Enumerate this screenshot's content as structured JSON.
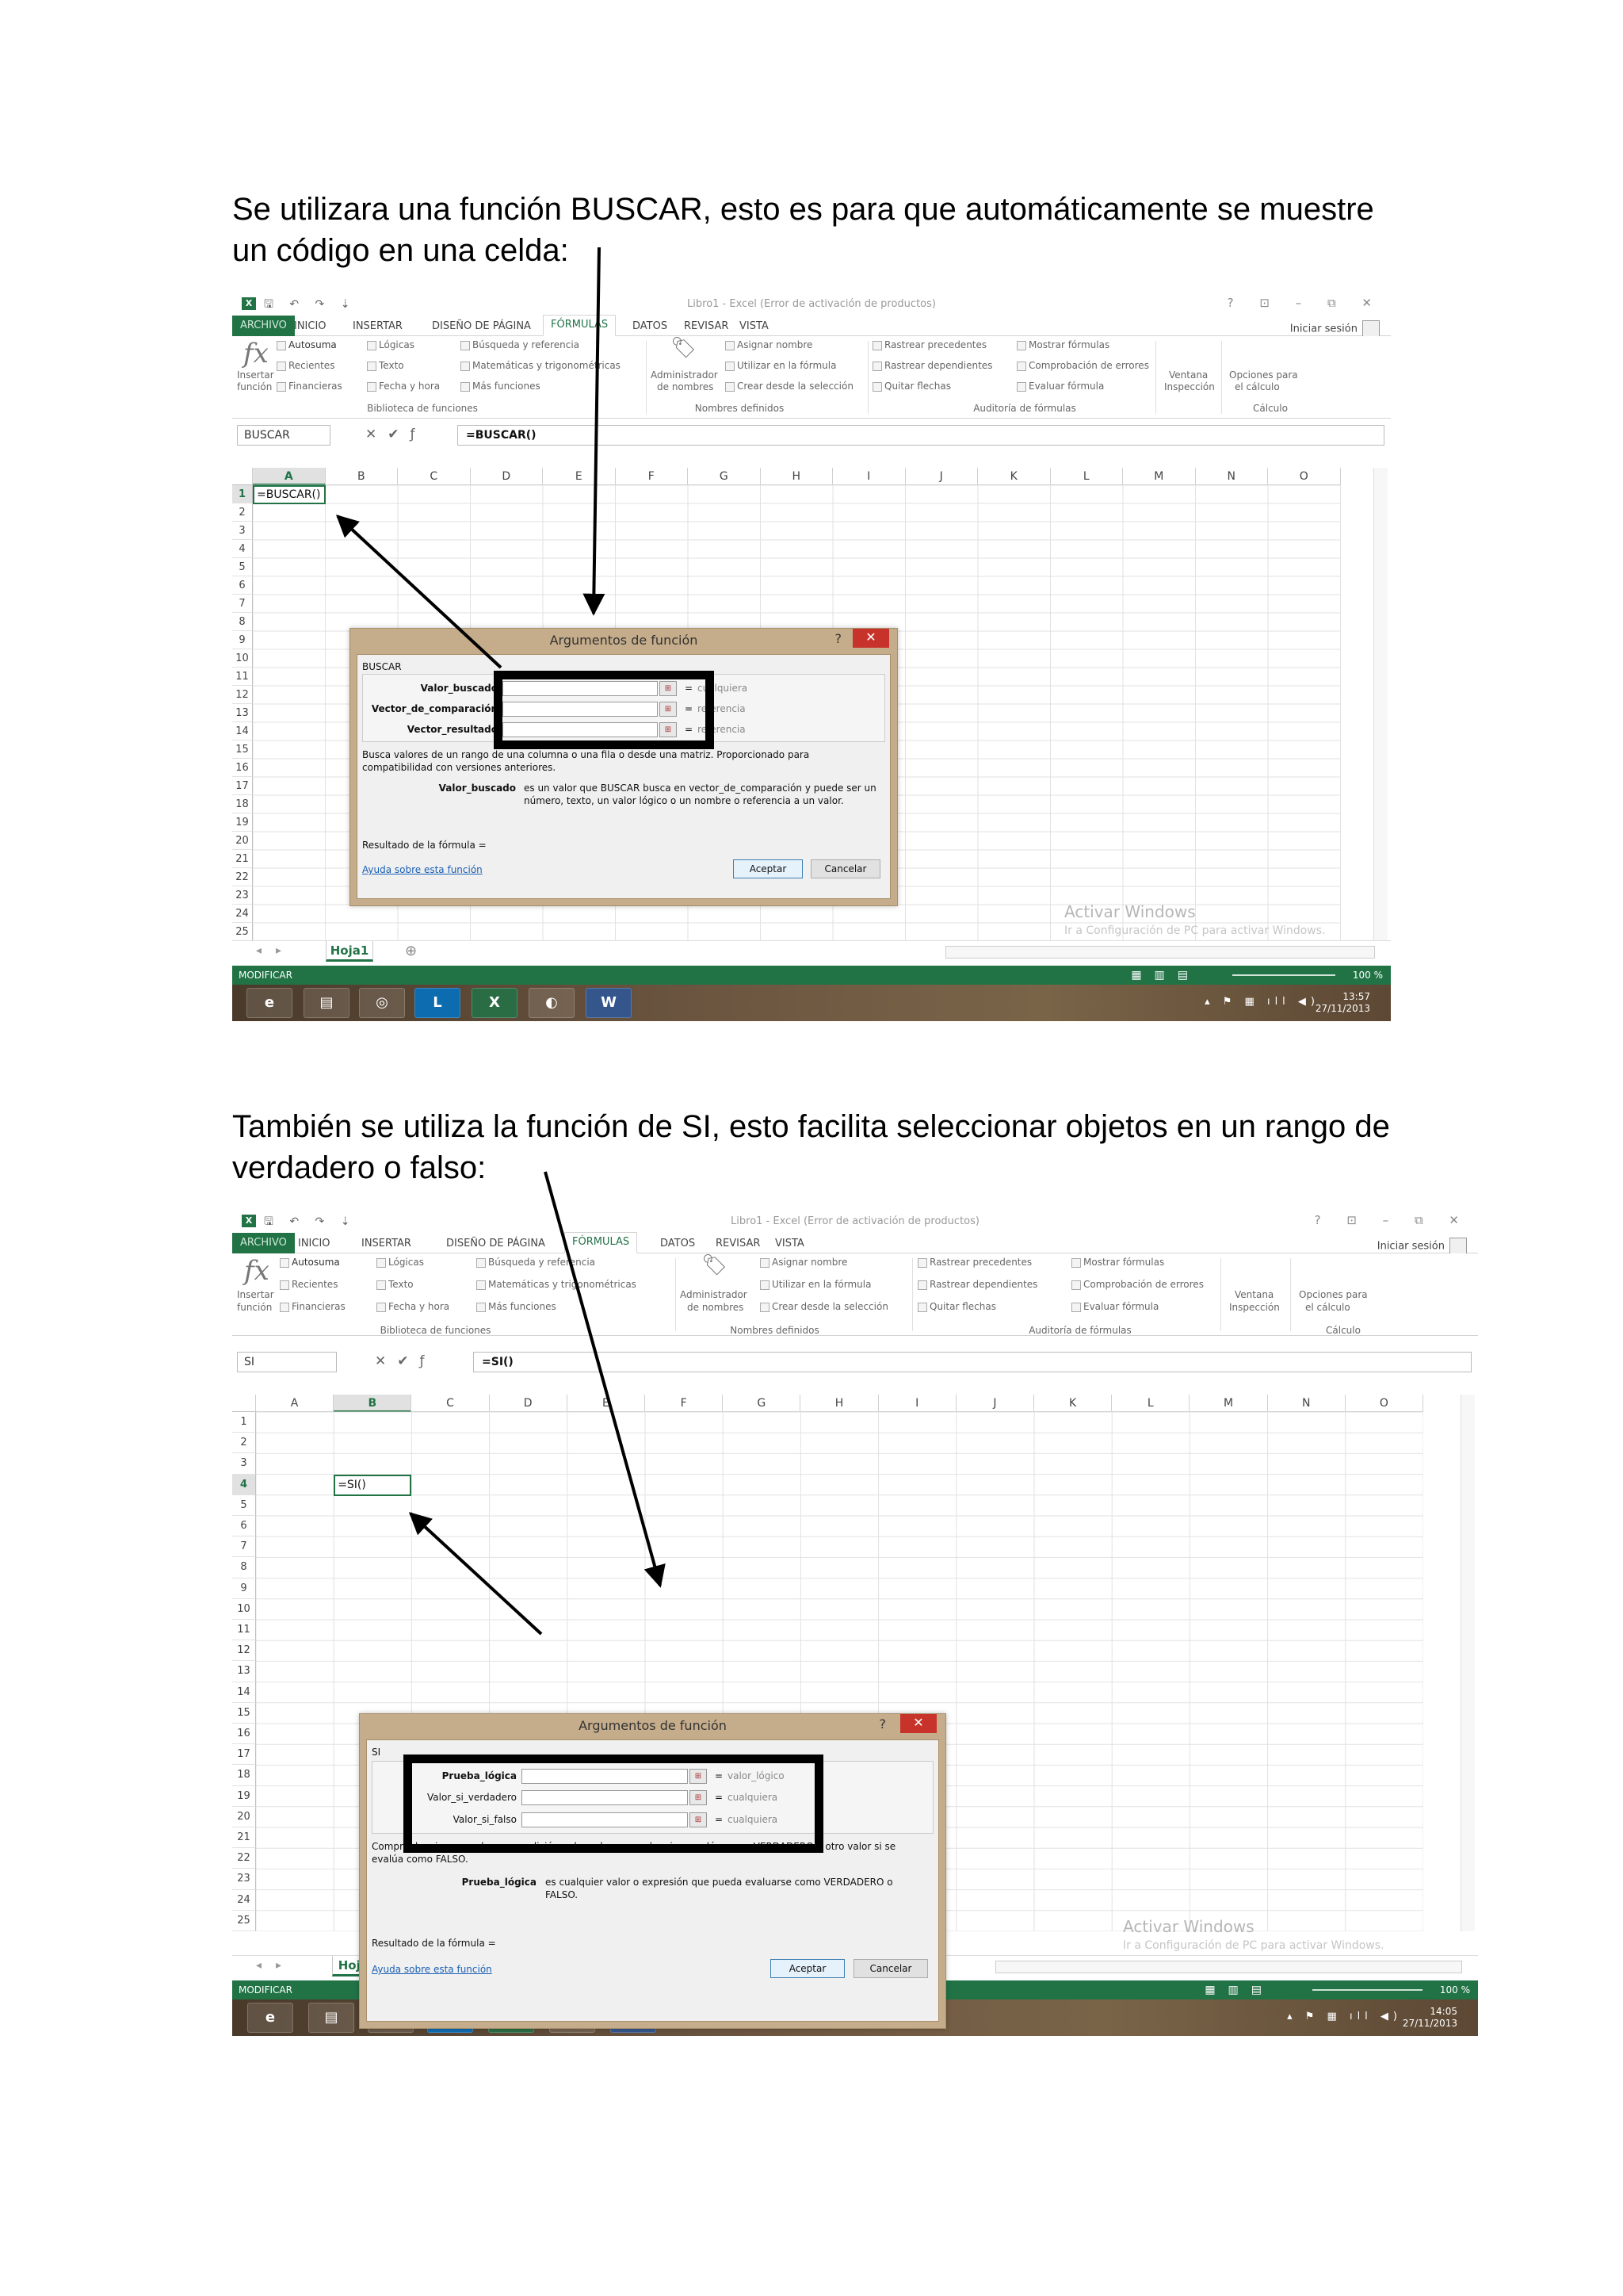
{
  "document": {
    "paragraph_1": "Se utilizara una función BUSCAR, esto es para que automáticamente se muestre un código en una celda:",
    "paragraph_2": "También se utiliza la función de SI, esto facilita seleccionar objetos en un rango de verdadero o falso:"
  },
  "excel_common": {
    "window_title": "Libro1 - Excel (Error de activación de productos)",
    "window_controls": "? ⊡ – ⧉ ✕",
    "quick_access": "🖫 ↶ ↷ ⇣",
    "tabs": [
      "ARCHIVO",
      "INICIO",
      "INSERTAR",
      "DISEÑO DE PÁGINA",
      "FÓRMULAS",
      "DATOS",
      "REVISAR",
      "VISTA"
    ],
    "active_tab": "FÓRMULAS",
    "signin": "Iniciar sesión",
    "ribbon": {
      "insert_function": "Insertar función",
      "insert_function_l1": "Insertar",
      "insert_function_l2": "función",
      "autosum": "Autosuma",
      "recent": "Recientes",
      "financial": "Financieras",
      "logical": "Lógicas",
      "text": "Texto",
      "datetime": "Fecha y hora",
      "lookup": "Búsqueda y referencia",
      "math": "Matemáticas y trigonométricas",
      "more": "Más funciones",
      "group_library": "Biblioteca de funciones",
      "name_manager_l1": "Administrador",
      "name_manager_l2": "de nombres",
      "define_name": "Asignar nombre",
      "use_in_formula": "Utilizar en la fórmula",
      "create_from_selection": "Crear desde la selección",
      "group_names": "Nombres definidos",
      "trace_precedents": "Rastrear precedentes",
      "trace_dependents": "Rastrear dependientes",
      "remove_arrows": "Quitar flechas",
      "show_formulas": "Mostrar fórmulas",
      "error_checking": "Comprobación de errores",
      "evaluate_formula": "Evaluar fórmula",
      "group_auditing": "Auditoría de fórmulas",
      "watch_window_l1": "Ventana",
      "watch_window_l2": "Inspección",
      "calc_options_l1": "Opciones para",
      "calc_options_l2": "el cálculo",
      "group_calc": "Cálculo"
    },
    "columns": [
      "A",
      "B",
      "C",
      "D",
      "E",
      "F",
      "G",
      "H",
      "I",
      "J",
      "K",
      "L",
      "M",
      "N",
      "O"
    ],
    "rows": [
      "1",
      "2",
      "3",
      "4",
      "5",
      "6",
      "7",
      "8",
      "9",
      "10",
      "11",
      "12",
      "13",
      "14",
      "15",
      "16",
      "17",
      "18",
      "19",
      "20",
      "21",
      "22",
      "23",
      "24",
      "25"
    ],
    "sheet_tab": "Hoja1",
    "add_sheet": "⊕",
    "status": "MODIFICAR",
    "zoom": "100 %",
    "watermark_title": "Activar Windows",
    "watermark_sub": "Ir a Configuración de PC para activar Windows.",
    "dialog_title": "Argumentos de función",
    "dialog_help": "?",
    "dialog_close": "✕",
    "formula_result": "Resultado de la fórmula =",
    "help_link": "Ayuda sobre esta función",
    "ok": "Aceptar",
    "cancel": "Cancelar",
    "eq": "="
  },
  "shot1": {
    "name_box": "BUSCAR",
    "formula": "=BUSCAR()",
    "active_cell_text": "=BUSCAR()",
    "active_col": "A",
    "active_row": "1",
    "function_name": "BUSCAR",
    "args": [
      {
        "label": "Valor_buscado",
        "hint": "cualquiera"
      },
      {
        "label": "Vector_de_comparación",
        "hint": "referencia"
      },
      {
        "label": "Vector_resultado",
        "hint": "referencia"
      }
    ],
    "description": "Busca valores de un rango de una columna o una fila o desde una matriz. Proporcionado para compatibilidad con versiones anteriores.",
    "arg_name": "Valor_buscado",
    "arg_description": "es un valor que BUSCAR busca en vector_de_comparación y puede ser un número, texto, un valor lógico o un nombre o referencia a un valor.",
    "time": "13:57",
    "date": "27/11/2013"
  },
  "shot2": {
    "name_box": "SI",
    "formula": "=SI()",
    "active_cell_text": "=SI()",
    "active_col": "B",
    "active_row": "4",
    "function_name": "SI",
    "args": [
      {
        "label": "Prueba_lógica",
        "hint": "valor_lógico"
      },
      {
        "label": "Valor_si_verdadero",
        "hint": "cualquiera"
      },
      {
        "label": "Valor_si_falso",
        "hint": "cualquiera"
      }
    ],
    "description": "Comprueba si se cumple una condición y devuelve una valor si se evalúa como VERDADERO y otro valor si se evalúa como FALSO.",
    "arg_name": "Prueba_lógica",
    "arg_description": "es cualquier valor o expresión que pueda evaluarse como VERDADERO o FALSO.",
    "time": "14:05",
    "date": "27/11/2013"
  },
  "taskbar": {
    "apps": [
      {
        "name": "internet-explorer",
        "glyph": "e"
      },
      {
        "name": "file-explorer",
        "glyph": "▤"
      },
      {
        "name": "chrome",
        "glyph": "◎"
      },
      {
        "name": "lync",
        "glyph": "L"
      },
      {
        "name": "excel",
        "glyph": "X"
      },
      {
        "name": "dual-monitor",
        "glyph": "◐"
      },
      {
        "name": "word",
        "glyph": "W"
      }
    ],
    "tray": "▴ ⚑ ▦ ıll ◀)"
  },
  "colors": {
    "excel_green": "#217346",
    "dialog_frame": "#c5ac8a",
    "close_red": "#c7322a",
    "link_blue": "#1a5fb4"
  }
}
